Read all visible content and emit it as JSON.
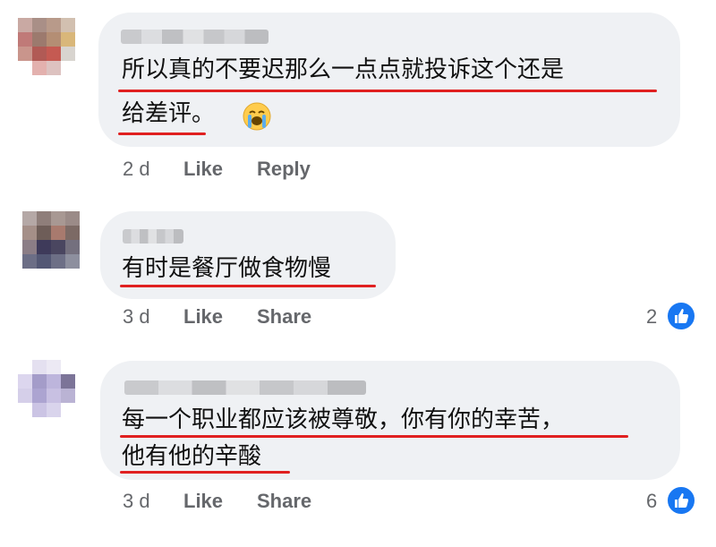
{
  "comments": [
    {
      "lines": [
        "所以真的不要迟那么一点点就投诉这个还是",
        "给差评。"
      ],
      "emoji": "loudly-crying-face-emoji",
      "time": "2 d",
      "actions": [
        "Like",
        "Reply"
      ],
      "reactions": null
    },
    {
      "lines": [
        "有时是餐厅做食物慢"
      ],
      "time": "3 d",
      "actions": [
        "Like",
        "Share"
      ],
      "reactions": "2"
    },
    {
      "lines": [
        "每一个职业都应该被尊敬，你有你的幸苦，",
        "他有他的辛酸"
      ],
      "time": "3 d",
      "actions": [
        "Like",
        "Share"
      ],
      "reactions": "6"
    }
  ],
  "colors": {
    "bubble": "#eff1f4",
    "underline": "#e02020",
    "meta_text": "#65676b",
    "like_blue": "#1877f2"
  },
  "icons": {
    "reaction": "thumbs-up-icon",
    "emoji": "loudly-crying-face-emoji"
  }
}
